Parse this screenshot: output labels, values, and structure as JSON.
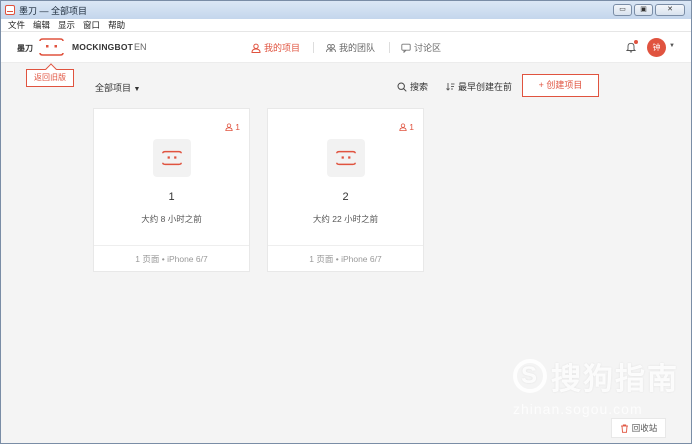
{
  "window": {
    "title": "墨刀 — 全部项目",
    "buttons": [
      "▭",
      "▣",
      "✕"
    ]
  },
  "menu": [
    "文件",
    "编辑",
    "显示",
    "窗口",
    "帮助"
  ],
  "nav": {
    "brand_cn": "墨刀",
    "brand_en": "MOCKINGBOT",
    "lang": "EN",
    "items": [
      {
        "label": "我的项目",
        "icon": "person-icon"
      },
      {
        "label": "我的团队",
        "icon": "team-icon"
      },
      {
        "label": "讨论区",
        "icon": "chat-icon"
      }
    ],
    "avatar": "钟",
    "accent": "#e0533f"
  },
  "old_version_label": "返回旧版",
  "toolbar": {
    "filter": "全部项目",
    "search": "搜索",
    "sort": "最早创建在前",
    "create": "创建项目"
  },
  "projects": [
    {
      "name": "1",
      "members": "1",
      "time": "大约 8 小时之前",
      "meta": "1 页面 • iPhone 6/7"
    },
    {
      "name": "2",
      "members": "1",
      "time": "大约 22 小时之前",
      "meta": "1 页面 • iPhone 6/7"
    }
  ],
  "trash": "回收站",
  "watermark": {
    "text": "搜狗指南",
    "logo": "S",
    "url": "zhinan.sogou.com"
  }
}
